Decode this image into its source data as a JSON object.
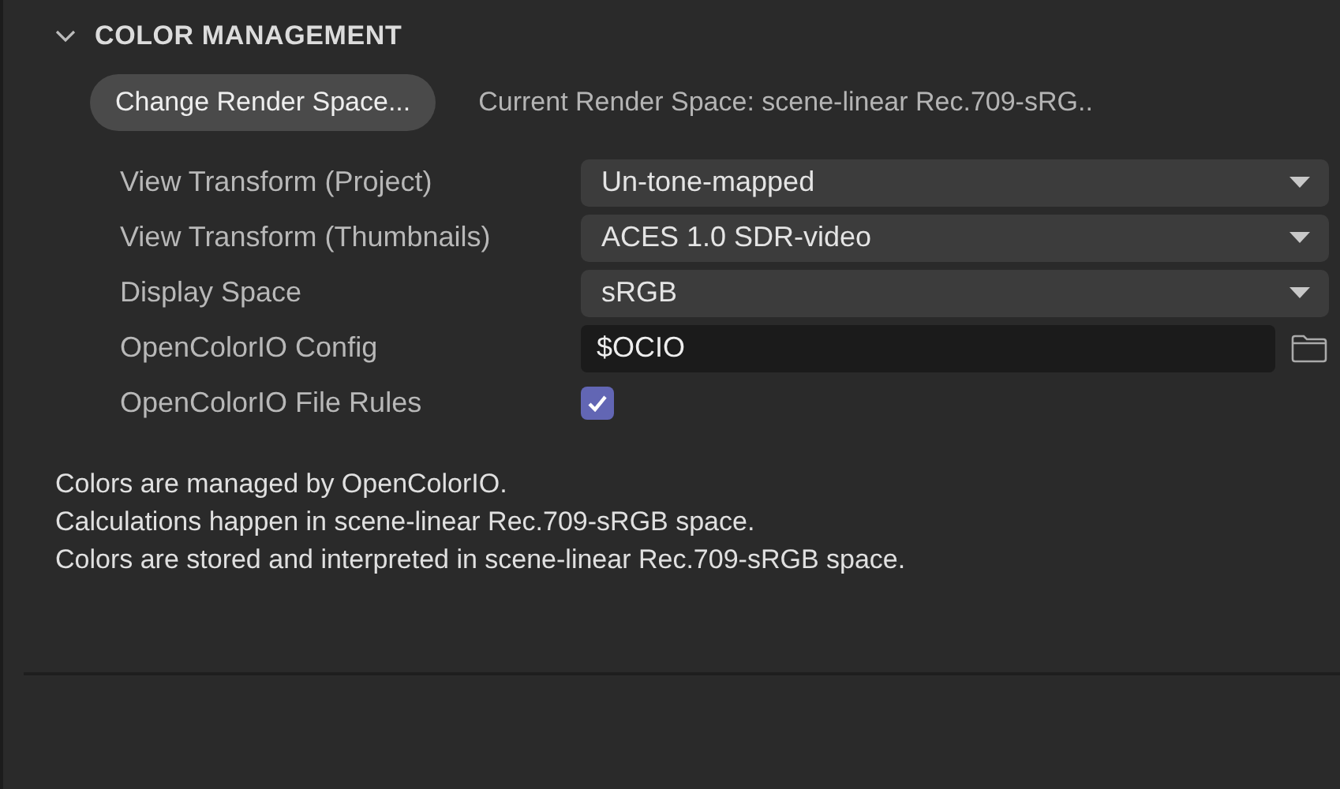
{
  "section": {
    "title": "COLOR MANAGEMENT",
    "expanded": true
  },
  "render_space": {
    "button": "Change Render Space...",
    "current": "Current Render Space: scene-linear Rec.709-sRG.."
  },
  "settings": [
    {
      "kind": "select",
      "label": "View Transform (Project)",
      "value": "Un-tone-mapped"
    },
    {
      "kind": "select",
      "label": "View Transform (Thumbnails)",
      "value": "ACES 1.0 SDR-video"
    },
    {
      "kind": "select",
      "label": "Display Space",
      "value": "sRGB"
    },
    {
      "kind": "path",
      "label": "OpenColorIO Config",
      "value": "$OCIO"
    },
    {
      "kind": "checkbox",
      "label": "OpenColorIO File Rules",
      "checked": true
    }
  ],
  "description": [
    "Colors are managed by OpenColorIO.",
    "Calculations happen in scene-linear Rec.709-sRGB space.",
    "Colors are stored and interpreted in scene-linear Rec.709-sRGB space."
  ]
}
